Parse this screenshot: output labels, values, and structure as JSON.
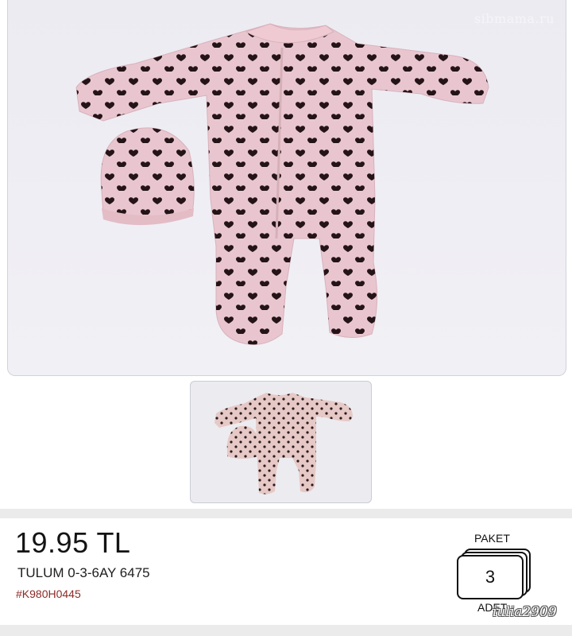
{
  "product": {
    "price": "19.95 TL",
    "name": "TULUM 0-3-6AY 6475",
    "code": "#K980H0445"
  },
  "package": {
    "top_label": "PAKET",
    "count": "3",
    "bottom_label": "ADET"
  },
  "watermarks": {
    "site": "sibmama.ru",
    "user": "iulia2909"
  },
  "colors": {
    "garment_pink": "#e9c6cf",
    "heart_dot": "#241418",
    "code_red": "#8b2a26"
  },
  "icons": [
    "main-product-image",
    "thumbnail-product-image"
  ]
}
